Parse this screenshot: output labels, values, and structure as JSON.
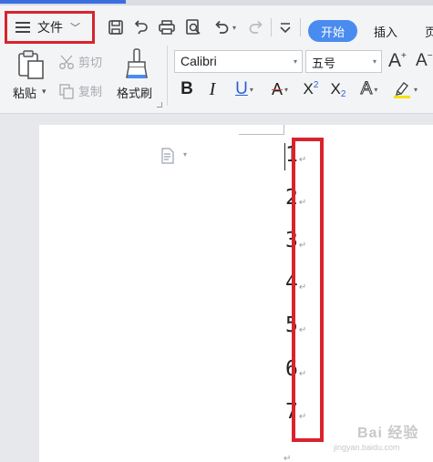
{
  "menu": {
    "file_label": "文件",
    "tabs": {
      "start": "开始",
      "insert": "插入",
      "page_partial": "页"
    }
  },
  "quick_access": [
    "save-icon",
    "undo-history-icon",
    "print-icon",
    "print-preview-icon",
    "undo-icon",
    "redo-icon",
    "more-icon"
  ],
  "clipboard": {
    "paste_label": "粘贴",
    "cut_label": "剪切",
    "copy_label": "复制",
    "format_painter_label": "格式刷"
  },
  "font": {
    "name": "Calibri",
    "size": "五号",
    "bold": "B",
    "italic": "I",
    "underline": "U",
    "strike": "A",
    "superscript_base": "X",
    "superscript_exp": "2",
    "subscript_base": "X",
    "subscript_exp": "2",
    "effects": "A",
    "grow": "A",
    "shrink": "A"
  },
  "colors": {
    "accent": "#4a8bf0",
    "highlight_box": "#d9232d",
    "text_color_bar": "#e8403a",
    "highlighter_bar": "#f6e10a"
  },
  "document": {
    "lines": [
      "1",
      "2",
      "3",
      "4",
      "5",
      "6",
      "7"
    ],
    "paragraph_mark": "↵"
  },
  "watermark": {
    "text": "Bai 经验",
    "sub": "jingyan.baidu.com"
  }
}
